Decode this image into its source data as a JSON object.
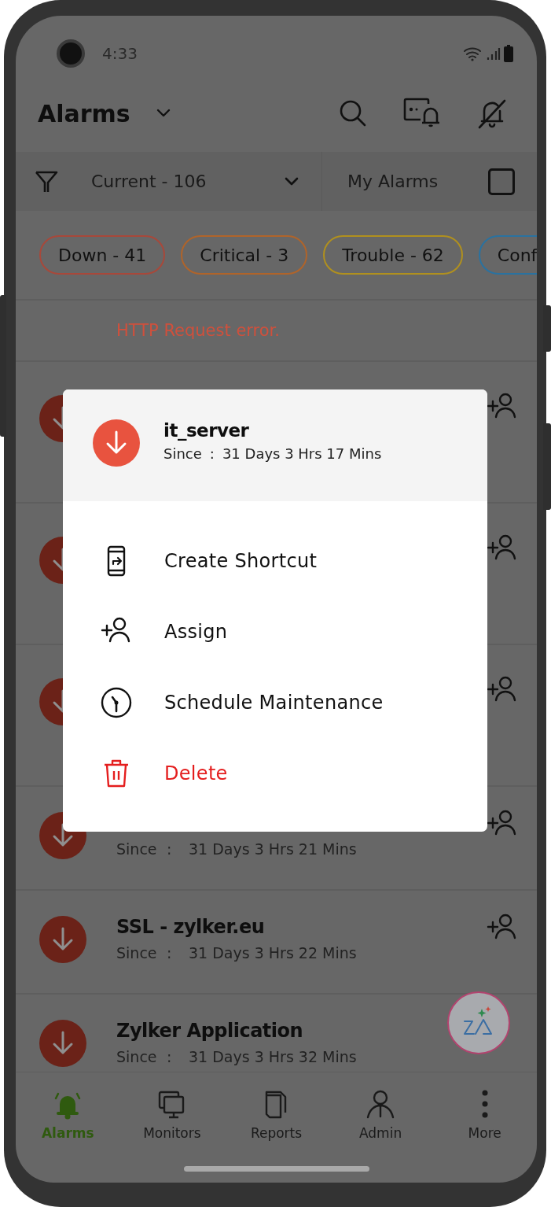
{
  "status_bar": {
    "time": "4:33"
  },
  "header": {
    "title": "Alarms"
  },
  "filter": {
    "view": "Current - 106",
    "my_alarms_label": "My Alarms",
    "my_alarms_checked": false
  },
  "chips": [
    {
      "label": "Down - 41",
      "color": "#a8483a"
    },
    {
      "label": "Critical - 3",
      "color": "#b0642a"
    },
    {
      "label": "Trouble - 62",
      "color": "#b0901e"
    },
    {
      "label": "Conf",
      "color": "#2a72a0"
    }
  ],
  "error_message": "HTTP Request error.",
  "alarms": [
    {
      "kind": "down",
      "assign_icon": true
    },
    {
      "kind": "down",
      "assign_icon": true
    },
    {
      "kind": "down",
      "assign_icon": true
    },
    {
      "kind": "down",
      "assign_icon": true,
      "since_label": "Since",
      "since_separator": ":",
      "since_value": "31 Days 3 Hrs 21 Mins"
    },
    {
      "kind": "down",
      "assign_icon": true,
      "title": "SSL - zylker.eu",
      "since_label": "Since",
      "since_separator": ":",
      "since_value": "31 Days 3 Hrs 22 Mins"
    },
    {
      "kind": "down",
      "assign_icon": false,
      "title": "Zylker Application",
      "since_label": "Since",
      "since_separator": ":",
      "since_value": "31 Days 3 Hrs 32 Mins"
    }
  ],
  "dialog": {
    "kind": "down",
    "title": "it_server",
    "since_label": "Since",
    "since_separator": ":",
    "since_value": "31 Days 3 Hrs 17 Mins",
    "actions": [
      {
        "kind": "shortcut",
        "label": "Create Shortcut"
      },
      {
        "kind": "assign",
        "label": "Assign"
      },
      {
        "kind": "maintenance",
        "label": "Schedule Maintenance"
      },
      {
        "kind": "delete",
        "label": "Delete"
      }
    ]
  },
  "bottom_nav": [
    {
      "kind": "alarms",
      "label": "Alarms",
      "selected": true
    },
    {
      "kind": "monitors",
      "label": "Monitors",
      "selected": false
    },
    {
      "kind": "reports",
      "label": "Reports",
      "selected": false
    },
    {
      "kind": "admin",
      "label": "Admin",
      "selected": false
    },
    {
      "kind": "more",
      "label": "More",
      "selected": false
    }
  ]
}
